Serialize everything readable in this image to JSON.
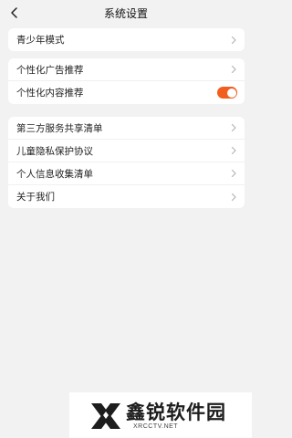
{
  "header": {
    "title": "系统设置",
    "back_icon": "chevron-left-icon"
  },
  "sections": [
    {
      "items": [
        {
          "label": "青少年模式",
          "control": "chevron"
        }
      ]
    },
    {
      "items": [
        {
          "label": "个性化广告推荐",
          "control": "chevron"
        },
        {
          "label": "个性化内容推荐",
          "control": "toggle",
          "toggle_on": true
        }
      ]
    },
    {
      "items": [
        {
          "label": "第三方服务共享清单",
          "control": "chevron"
        },
        {
          "label": "儿童隐私保护协议",
          "control": "chevron"
        },
        {
          "label": "个人信息收集清单",
          "control": "chevron"
        },
        {
          "label": "关于我们",
          "control": "chevron"
        }
      ]
    }
  ],
  "watermark": {
    "brand": "鑫锐软件园",
    "url": "XRCCTV.NET"
  },
  "colors": {
    "accent": "#f25e1f",
    "background": "#f2f2f2",
    "card": "#ffffff"
  }
}
